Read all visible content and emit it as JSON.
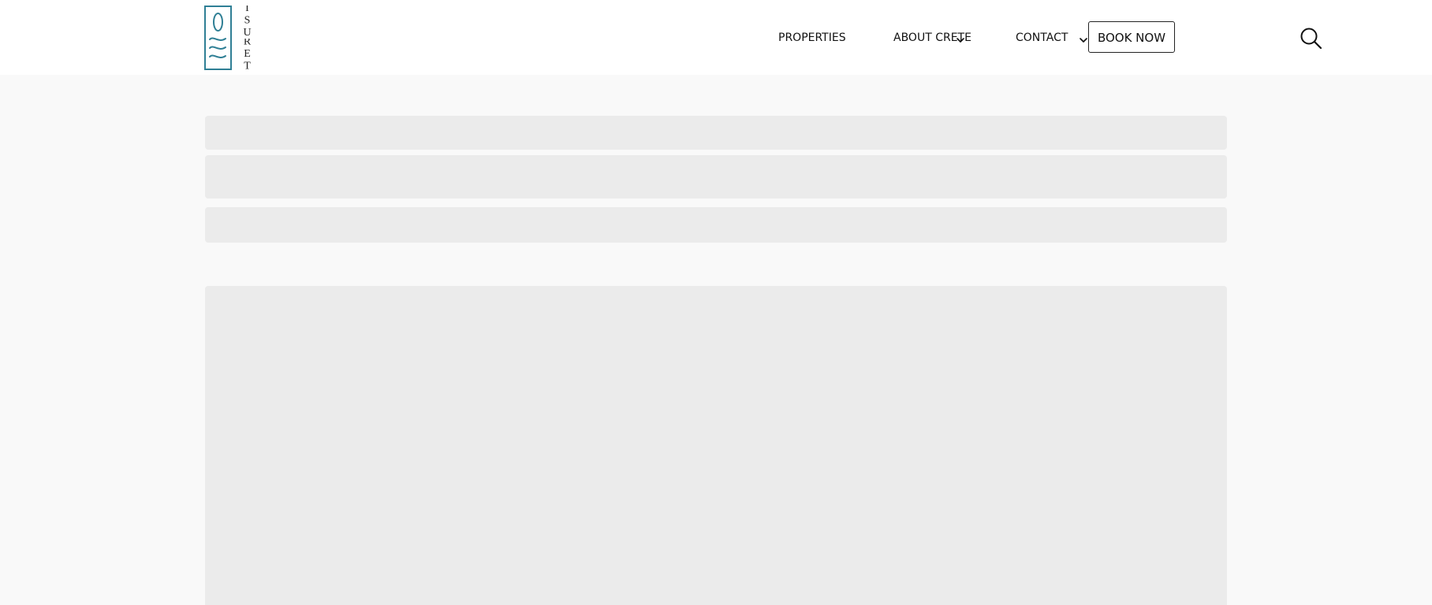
{
  "brand": {
    "word_top": "LEISURE",
    "word_bottom": "CRETE",
    "accent_color": "#2f7f95"
  },
  "nav": {
    "items": [
      {
        "label": "PROPERTIES"
      },
      {
        "label": "ABOUT CRETE"
      },
      {
        "label": "CONTACT"
      }
    ],
    "book_now_label": "BOOK NOW",
    "search_icon": "search-icon",
    "chevron_icon": "chevron-down-icon"
  },
  "placeholders": {
    "skeleton_color": "#ebebeb",
    "background_color": "#f9f9f9"
  }
}
